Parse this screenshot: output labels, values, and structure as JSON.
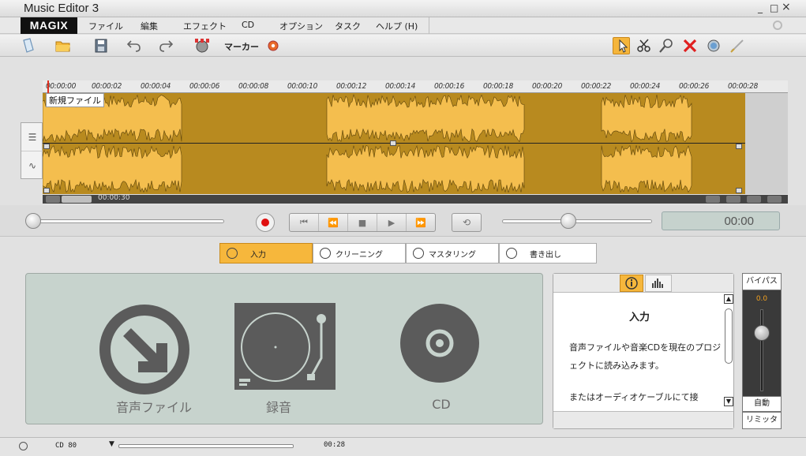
{
  "window": {
    "title": "Music Editor 3",
    "controls": {
      "minimize": "_",
      "maximize": "□",
      "close": "×"
    }
  },
  "menu": {
    "logo": "MAGIX",
    "items": [
      {
        "label": "ファイル"
      },
      {
        "label": "編集"
      },
      {
        "label": "エフェクト"
      },
      {
        "label": "CD"
      },
      {
        "label": "オプション"
      },
      {
        "label": "タスク"
      },
      {
        "label": "ヘルプ (H)"
      }
    ]
  },
  "toolbar": {
    "marker_label": "マーカー",
    "left_icons": [
      "new-file-icon",
      "open-folder-icon",
      "save-icon",
      "undo-icon",
      "redo-icon",
      "marker-set-icon",
      "marker-settings-icon"
    ],
    "right_icons": [
      "pointer-tool-icon",
      "cut-tool-icon",
      "zoom-tool-icon",
      "delete-tool-icon",
      "timer-tool-icon",
      "pen-tool-icon"
    ],
    "accent_color": "#f5b53b"
  },
  "timeline": {
    "ruler_ticks": [
      "00:00:00",
      "00:00:02",
      "00:00:04",
      "00:00:06",
      "00:00:08",
      "00:00:10",
      "00:00:12",
      "00:00:14",
      "00:00:16",
      "00:00:18",
      "00:00:20",
      "00:00:22",
      "00:00:24",
      "00:00:26",
      "00:00:28"
    ],
    "file_name": "新規ファイル",
    "scroll_time": "00:00:30",
    "waveform_color": "#f4be4e",
    "background_color": "#b88a1f"
  },
  "transport": {
    "buttons": [
      "skip-start",
      "rewind",
      "stop",
      "play",
      "fast-forward"
    ],
    "time": "00:00",
    "record_color": "#e01010"
  },
  "tabs": [
    {
      "label": "入力",
      "active": true
    },
    {
      "label": "クリーニング",
      "active": false
    },
    {
      "label": "マスタリング",
      "active": false
    },
    {
      "label": "書き出し",
      "active": false
    }
  ],
  "import_items": [
    {
      "label": "音声ファイル",
      "icon": "audio-file-import-icon"
    },
    {
      "label": "録音",
      "icon": "turntable-icon"
    },
    {
      "label": "CD",
      "icon": "cd-disc-icon"
    }
  ],
  "info_panel": {
    "title": "入力",
    "text": "音声ファイルや音楽CDを現在のプロジェクトに読み込みます。",
    "text2": "またはオーディオケーブルにて接"
  },
  "bypass": {
    "bypass_label": "バイパス",
    "meter_value": "0.0",
    "auto_label": "自動",
    "limiter_label": "リミッタ"
  },
  "status": {
    "cd_format": "CD 80",
    "length": "00:28"
  }
}
